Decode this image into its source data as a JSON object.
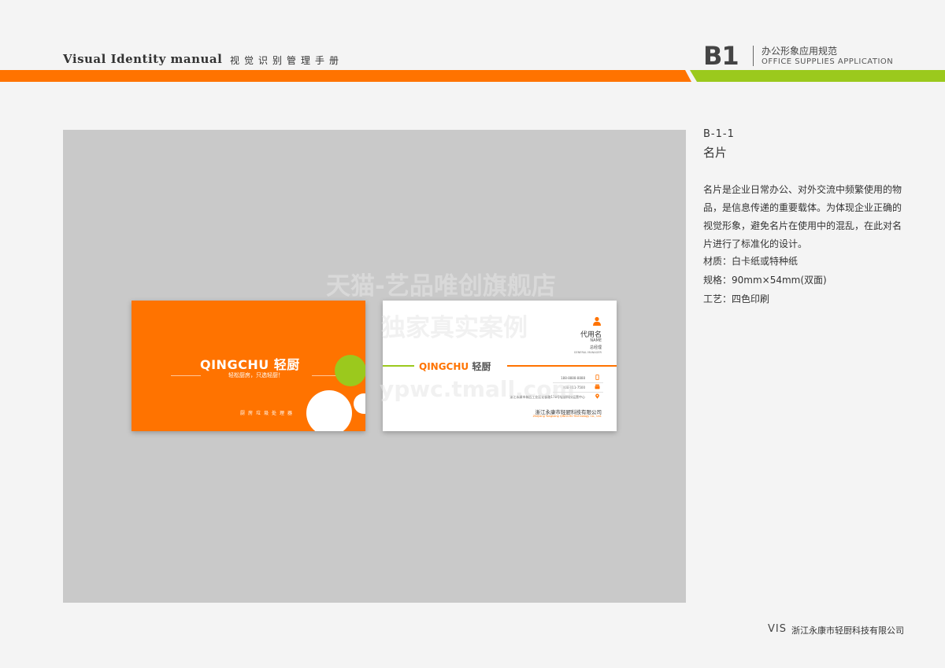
{
  "header": {
    "title": "Visual Identity  manual",
    "title_cn": "视觉识别管理手册",
    "code": "B1",
    "section_cn": "办公形象应用规范",
    "section_en": "OFFICE SUPPLIES APPLICATION",
    "colors": {
      "orange": "#ff7300",
      "green": "#9bc91d"
    }
  },
  "card_front": {
    "logo_en": "QINGCHU",
    "logo_cn": "轻厨",
    "slogan": "轻松厨房，只选轻厨！",
    "services": "厨房垃圾处理器"
  },
  "card_back": {
    "logo_en": "QINGCHU",
    "logo_cn": "轻厨",
    "name": "代用名",
    "name_en": "NAME",
    "title": "总经理",
    "title_en": "GENERAL MANAGER",
    "phone": "188-8888-8888",
    "hotline": "400-011-7500",
    "address": "浙江永康市城西工业区花都路178号轻厨科技运营中心",
    "company": "浙江永康市轻厨科技有限公司",
    "company_en": "Zhejiang Yongkang QINGCHU Technology Co., Ltd."
  },
  "watermark": {
    "line1": "天猫-艺品唯创旗舰店",
    "line2": "独家真实案例",
    "line3": "ypwc.tmall.com"
  },
  "section": {
    "id": "B-1-1",
    "title": "名片",
    "description": "名片是企业日常办公、对外交流中频繁使用的物品，是信息传递的重要载体。为体现企业正确的视觉形象，避免名片在使用中的混乱，在此对名片进行了标准化的设计。",
    "material": "材质：白卡纸或特种纸",
    "size": "规格：90mm×54mm(双面)",
    "craft": "工艺：四色印刷"
  },
  "footer": {
    "vis": "VIS",
    "company": "浙江永康市轻厨科技有限公司"
  }
}
